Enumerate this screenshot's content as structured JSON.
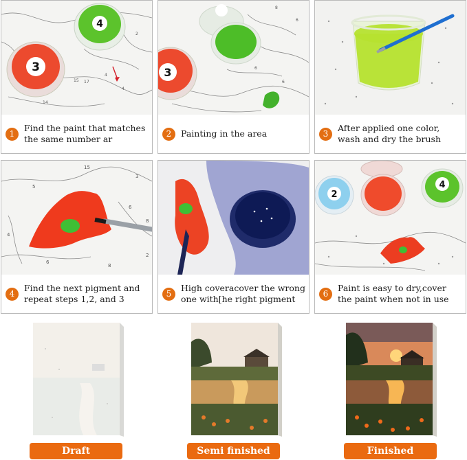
{
  "steps": [
    {
      "number": "1",
      "text": "Find the paint that matches the same number ar"
    },
    {
      "number": "2",
      "text": "Painting in the area"
    },
    {
      "number": "3",
      "text": "After applied one color, wash and dry the brush"
    },
    {
      "number": "4",
      "text": "Find the next pigment and repeat steps 1,2, and 3"
    },
    {
      "number": "5",
      "text": "High coveracover the wrong one with[he right pigment"
    },
    {
      "number": "6",
      "text": "Paint is easy to dry,cover the paint when not in use"
    }
  ],
  "pot_labels": {
    "step1_green": "4",
    "step1_red": "3",
    "step2_red": "3",
    "step6_blue": "2",
    "step6_green": "4"
  },
  "stages": [
    {
      "label": "Draft"
    },
    {
      "label": "Semi finished"
    },
    {
      "label": "Finished"
    }
  ],
  "colors": {
    "step_badge": "#e36e12",
    "stage_label_bg": "#ea6a10",
    "paint_red": "#e8432a",
    "paint_green": "#4fbf2a",
    "paint_blue": "#1a2a6e"
  },
  "icons": [
    "paint-pot",
    "brush",
    "water-cup",
    "arrow"
  ]
}
